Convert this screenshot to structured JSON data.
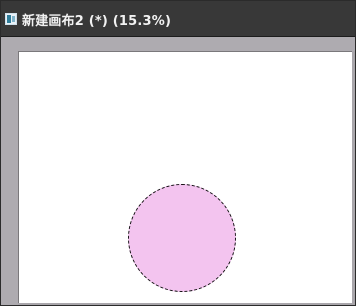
{
  "window": {
    "title": "新建画布2 (*) (15.3%)"
  },
  "icons": {
    "document": "document-icon"
  },
  "colors": {
    "titlebar": "#383838",
    "workspace": "#a9a6ab",
    "canvas": "#ffffff",
    "shape_fill": "#f3c4ef",
    "selection": "#111111"
  },
  "canvas": {
    "shape": "circle",
    "selection": "marching-ants"
  }
}
